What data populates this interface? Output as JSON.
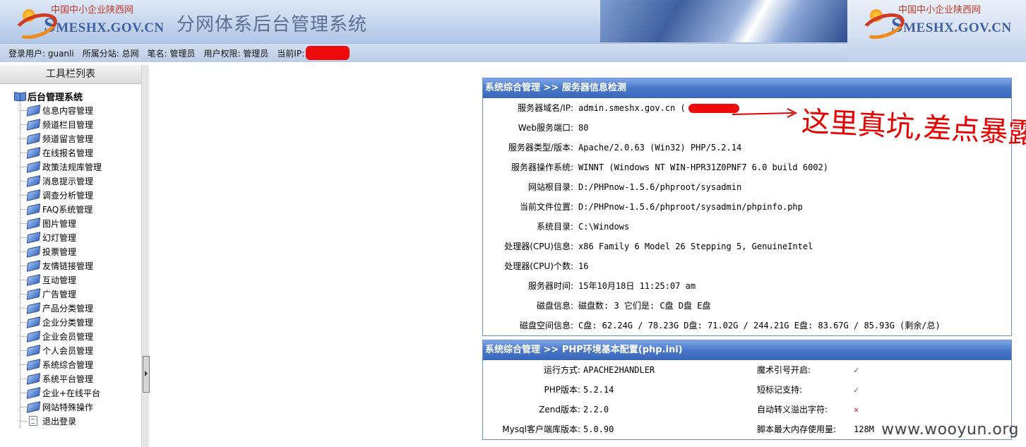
{
  "header": {
    "logo_cn": "中国中小企业陕西网",
    "logo_en_prefix": "S",
    "logo_en": "MESHX.GOV.CN",
    "system_title": "分网体系后台管理系统",
    "colors": {
      "logo_red": "#c53a28",
      "logo_blue": "#3e5ea5",
      "redaction": "#ee0b0b"
    }
  },
  "userbar": {
    "user": "登录用户: guanli",
    "branch": "所属分站: 总网",
    "nickname": "笔名: 管理员",
    "permission": "用户权限: 管理员",
    "ip_label": "当前IP:"
  },
  "sidebar": {
    "title": "工具栏列表",
    "root": "后台管理系统",
    "items": [
      "信息内容管理",
      "频道栏目管理",
      "频道留言管理",
      "在线报名管理",
      "政策法规库管理",
      "消息提示管理",
      "调查分析管理",
      "FAQ系统管理",
      "图片管理",
      "幻灯管理",
      "投票管理",
      "友情链接管理",
      "互动管理",
      "广告管理",
      "产品分类管理",
      "企业分类管理",
      "企业会员管理",
      "个人会员管理",
      "系统综合管理",
      "系统平台管理",
      "企业+在线平台",
      "网站特殊操作",
      "退出登录"
    ]
  },
  "server_panel": {
    "title": "系统综合管理 >> 服务器信息检测",
    "rows": [
      {
        "k": "服务器域名/IP:",
        "v": "admin.smeshx.gov.cn  ("
      },
      {
        "k": "Web服务端口:",
        "v": "80"
      },
      {
        "k": "服务器类型/版本:",
        "v": "Apache/2.0.63 (Win32) PHP/5.2.14"
      },
      {
        "k": "服务器操作系统:",
        "v": "WINNT  (Windows NT WIN-HPR31Z0PNF7 6.0 build 6002)"
      },
      {
        "k": "网站根目录:",
        "v": "D:/PHPnow-1.5.6/phproot/sysadmin"
      },
      {
        "k": "当前文件位置:",
        "v": "D:/PHPnow-1.5.6/phproot/sysadmin/phpinfo.php"
      },
      {
        "k": "系统目录:",
        "v": "C:\\Windows"
      },
      {
        "k": "处理器(CPU)信息:",
        "v": "x86 Family 6 Model 26 Stepping 5, GenuineIntel"
      },
      {
        "k": "处理器(CPU)个数:",
        "v": "16"
      },
      {
        "k": "服务器时间:",
        "v": "15年10月18日 11:25:07 am"
      },
      {
        "k": "磁盘信息:",
        "v": "磁盘数: 3  它们是: C盘  D盘  E盘"
      },
      {
        "k": "磁盘空间信息:",
        "v": "C盘: 62.24G  /  78.23G  D盘: 71.02G  /  244.21G  E盘: 83.67G  /  85.93G  (剩余/总)"
      }
    ]
  },
  "php_panel": {
    "title": "系统综合管理 >> PHP环境基本配置(php.ini)",
    "rows": [
      {
        "k1": "运行方式:",
        "v1": "APACHE2HANDLER",
        "k2": "魔术引号开启:",
        "v2": "✓",
        "v2_state": "ok"
      },
      {
        "k1": "PHP版本:",
        "v1": "5.2.14",
        "k2": "短标记支持:",
        "v2": "✓",
        "v2_state": "ok"
      },
      {
        "k1": "Zend版本:",
        "v1": "2.2.0",
        "k2": "自动转义溢出字符:",
        "v2": "✕",
        "v2_state": "no"
      },
      {
        "k1": "Mysql客户端库版本:",
        "v1": "5.0.90",
        "k2": "脚本最大内存使用量:",
        "v2": "128M",
        "v2_state": "text"
      }
    ]
  },
  "annotation": {
    "text": "这里真坑,差点暴露"
  },
  "watermark": "www.wooyun.org"
}
